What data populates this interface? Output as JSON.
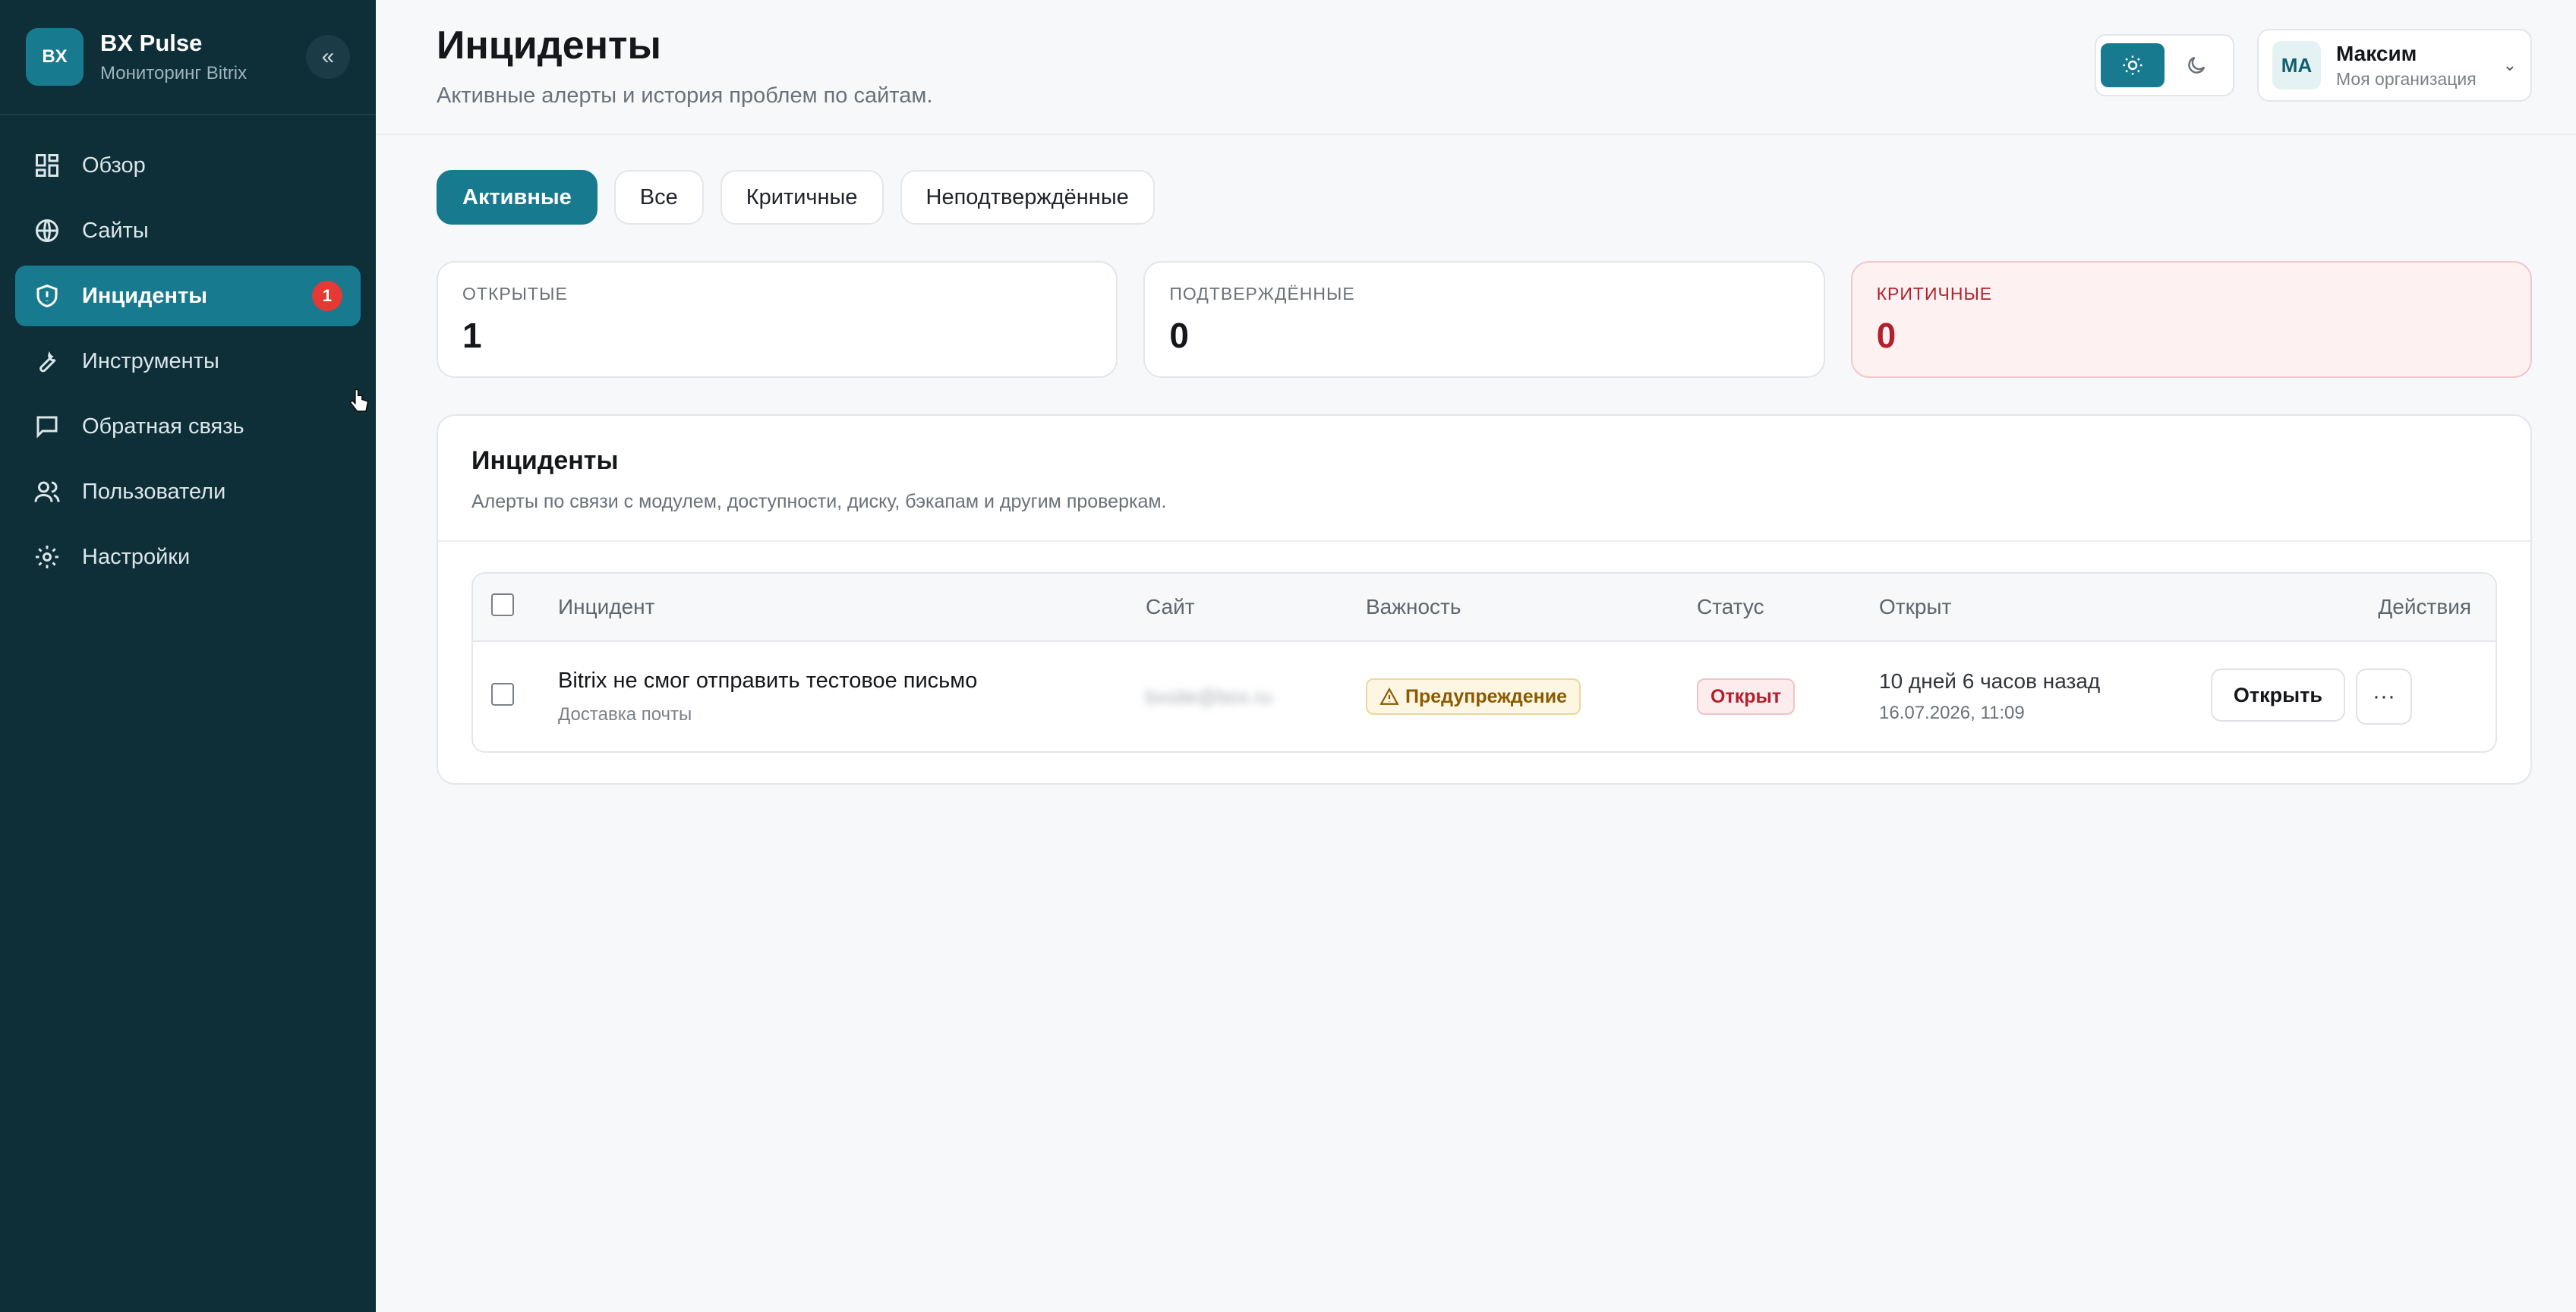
{
  "sidebar": {
    "logo": "BX",
    "brand_name": "BX Pulse",
    "brand_sub": "Мониторинг Bitrix",
    "collapse": "«",
    "items": [
      {
        "label": "Обзор",
        "icon": "dashboard-icon"
      },
      {
        "label": "Сайты",
        "icon": "globe-icon"
      },
      {
        "label": "Инциденты",
        "icon": "shield-icon",
        "badge": "1",
        "active": true
      },
      {
        "label": "Инструменты",
        "icon": "wrench-icon"
      },
      {
        "label": "Обратная связь",
        "icon": "chat-icon"
      },
      {
        "label": "Пользователи",
        "icon": "users-icon"
      },
      {
        "label": "Настройки",
        "icon": "gear-icon"
      }
    ]
  },
  "header": {
    "title": "Инциденты",
    "subtitle": "Активные алерты и история проблем по сайтам.",
    "user": {
      "initials": "МА",
      "name": "Максим",
      "org": "Моя организация"
    }
  },
  "filters": [
    "Активные",
    "Все",
    "Критичные",
    "Неподтверждённые"
  ],
  "stats": [
    {
      "label": "ОТКРЫТЫЕ",
      "value": "1"
    },
    {
      "label": "ПОДТВЕРЖДЁННЫЕ",
      "value": "0"
    },
    {
      "label": "КРИТИЧНЫЕ",
      "value": "0"
    }
  ],
  "card": {
    "title": "Инциденты",
    "subtitle": "Алерты по связи с модулем, доступности, диску, бэкапам и другим проверкам."
  },
  "table": {
    "columns": [
      "Инцидент",
      "Сайт",
      "Важность",
      "Статус",
      "Открыт",
      "Действия"
    ],
    "rows": [
      {
        "title": "Bitrix не смог отправить тестовое письмо",
        "subtitle": "Доставка почты",
        "site": "bxsite@box.ru",
        "severity": "Предупреждение",
        "status": "Открыт",
        "opened_rel": "10 дней 6 часов назад",
        "opened_abs": "16.07.2026, 11:09",
        "action_open": "Открыть",
        "action_more": "···"
      }
    ]
  },
  "colors": {
    "accent": "#187a8f",
    "sidebar": "#0e2e38",
    "danger": "#b3202c"
  }
}
